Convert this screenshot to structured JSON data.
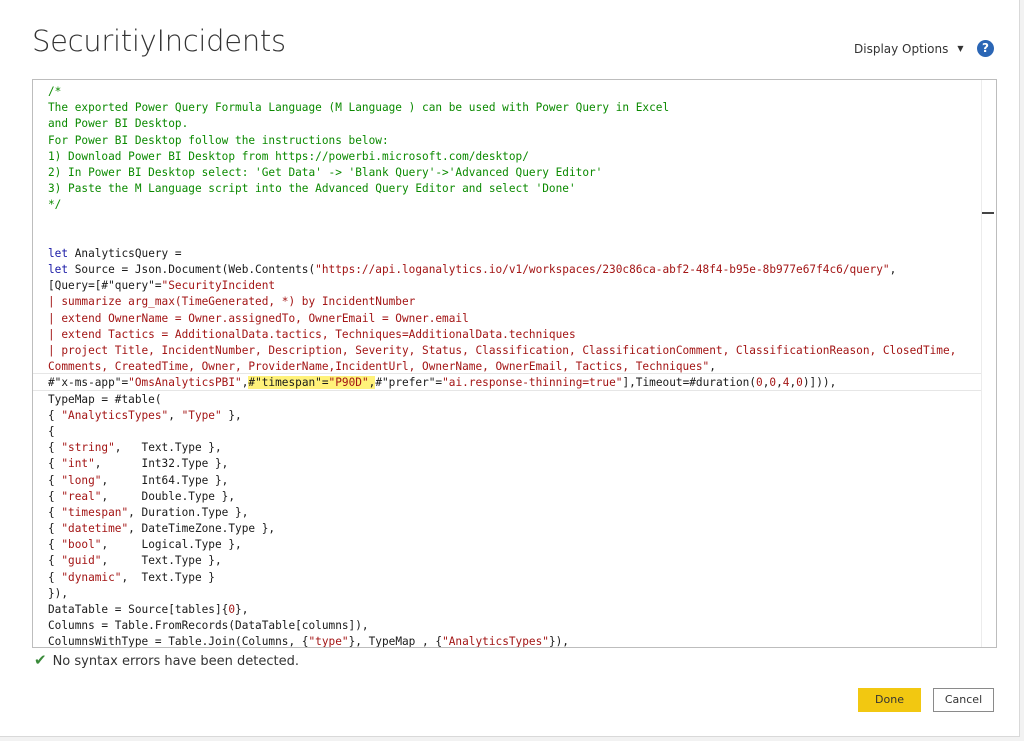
{
  "window": {
    "title": "SecuritiyIncidents"
  },
  "header": {
    "display_options_label": "Display Options",
    "help_label": "?"
  },
  "editor": {
    "lines": [
      [
        {
          "t": "/*",
          "c": "cm"
        }
      ],
      [
        {
          "t": "The exported Power Query Formula Language (M Language ) can be used with Power Query in Excel",
          "c": "cm"
        }
      ],
      [
        {
          "t": "and Power BI Desktop.",
          "c": "cm"
        }
      ],
      [
        {
          "t": "For Power BI Desktop follow the instructions below:",
          "c": "cm"
        }
      ],
      [
        {
          "t": "1) Download Power BI Desktop from https://powerbi.microsoft.com/desktop/",
          "c": "cm"
        }
      ],
      [
        {
          "t": "2) In Power BI Desktop select: 'Get Data' -> 'Blank Query'->'Advanced Query Editor'",
          "c": "cm"
        }
      ],
      [
        {
          "t": "3) Paste the M Language script into the Advanced Query Editor and select 'Done'",
          "c": "cm"
        }
      ],
      [
        {
          "t": "*/",
          "c": "cm"
        }
      ],
      [],
      [],
      [
        {
          "t": "let",
          "c": "kw"
        },
        {
          "t": " AnalyticsQuery =",
          "c": ""
        }
      ],
      [
        {
          "t": "let",
          "c": "kw"
        },
        {
          "t": " Source = Json.Document(Web.Contents(",
          "c": ""
        },
        {
          "t": "\"https://api.loganalytics.io/v1/workspaces/230c86ca-abf2-48f4-b95e-8b977e67f4c6/query\"",
          "c": "st"
        },
        {
          "t": ",",
          "c": ""
        }
      ],
      [
        {
          "t": "[Query=[#\"query\"=",
          "c": ""
        },
        {
          "t": "\"SecurityIncident",
          "c": "st"
        }
      ],
      [
        {
          "t": "| summarize arg_max(TimeGenerated, *) by IncidentNumber",
          "c": "st"
        }
      ],
      [
        {
          "t": "| extend OwnerName = Owner.assignedTo, OwnerEmail = Owner.email",
          "c": "st"
        }
      ],
      [
        {
          "t": "| extend Tactics = AdditionalData.tactics, Techniques=AdditionalData.techniques",
          "c": "st"
        }
      ],
      [
        {
          "t": "| project Title, IncidentNumber, Description, Severity, Status, Classification, ClassificationComment, ClassificationReason, ClosedTime,",
          "c": "st"
        }
      ],
      [
        {
          "t": "Comments, CreatedTime, Owner, ProviderName,IncidentUrl, OwnerName, OwnerEmail, Tactics, Techniques\"",
          "c": "st"
        },
        {
          "t": ",",
          "c": ""
        }
      ],
      [
        {
          "t": "#\"x-ms-app\"=",
          "c": ""
        },
        {
          "t": "\"OmsAnalyticsPBI\"",
          "c": "st"
        },
        {
          "t": ",",
          "c": ""
        },
        {
          "t": "#\"timespan\"=",
          "c": "hl"
        },
        {
          "t": "\"P90D\"",
          "c": "st hl"
        },
        {
          "t": ",",
          "c": "hl"
        },
        {
          "t": "#\"prefer\"=",
          "c": ""
        },
        {
          "t": "\"ai.response-thinning=true\"",
          "c": "st"
        },
        {
          "t": "],Timeout=#duration(",
          "c": ""
        },
        {
          "t": "0",
          "c": "st"
        },
        {
          "t": ",",
          "c": ""
        },
        {
          "t": "0",
          "c": "st"
        },
        {
          "t": ",",
          "c": ""
        },
        {
          "t": "4",
          "c": "st"
        },
        {
          "t": ",",
          "c": ""
        },
        {
          "t": "0",
          "c": "st"
        },
        {
          "t": ")])),",
          "c": ""
        }
      ],
      [
        {
          "t": "TypeMap = #table(",
          "c": ""
        }
      ],
      [
        {
          "t": "{ ",
          "c": ""
        },
        {
          "t": "\"AnalyticsTypes\"",
          "c": "st"
        },
        {
          "t": ", ",
          "c": ""
        },
        {
          "t": "\"Type\"",
          "c": "st"
        },
        {
          "t": " },",
          "c": ""
        }
      ],
      [
        {
          "t": "{",
          "c": ""
        }
      ],
      [
        {
          "t": "{ ",
          "c": ""
        },
        {
          "t": "\"string\"",
          "c": "st"
        },
        {
          "t": ",   Text.Type },",
          "c": ""
        }
      ],
      [
        {
          "t": "{ ",
          "c": ""
        },
        {
          "t": "\"int\"",
          "c": "st"
        },
        {
          "t": ",      Int32.Type },",
          "c": ""
        }
      ],
      [
        {
          "t": "{ ",
          "c": ""
        },
        {
          "t": "\"long\"",
          "c": "st"
        },
        {
          "t": ",     Int64.Type },",
          "c": ""
        }
      ],
      [
        {
          "t": "{ ",
          "c": ""
        },
        {
          "t": "\"real\"",
          "c": "st"
        },
        {
          "t": ",     Double.Type },",
          "c": ""
        }
      ],
      [
        {
          "t": "{ ",
          "c": ""
        },
        {
          "t": "\"timespan\"",
          "c": "st"
        },
        {
          "t": ", Duration.Type },",
          "c": ""
        }
      ],
      [
        {
          "t": "{ ",
          "c": ""
        },
        {
          "t": "\"datetime\"",
          "c": "st"
        },
        {
          "t": ", DateTimeZone.Type },",
          "c": ""
        }
      ],
      [
        {
          "t": "{ ",
          "c": ""
        },
        {
          "t": "\"bool\"",
          "c": "st"
        },
        {
          "t": ",     Logical.Type },",
          "c": ""
        }
      ],
      [
        {
          "t": "{ ",
          "c": ""
        },
        {
          "t": "\"guid\"",
          "c": "st"
        },
        {
          "t": ",     Text.Type },",
          "c": ""
        }
      ],
      [
        {
          "t": "{ ",
          "c": ""
        },
        {
          "t": "\"dynamic\"",
          "c": "st"
        },
        {
          "t": ",  Text.Type }",
          "c": ""
        }
      ],
      [
        {
          "t": "}),",
          "c": ""
        }
      ],
      [
        {
          "t": "DataTable = Source[tables]{",
          "c": ""
        },
        {
          "t": "0",
          "c": "st"
        },
        {
          "t": "},",
          "c": ""
        }
      ],
      [
        {
          "t": "Columns = Table.FromRecords(DataTable[columns]),",
          "c": ""
        }
      ],
      [
        {
          "t": "ColumnsWithType = Table.Join(Columns, {",
          "c": ""
        },
        {
          "t": "\"type\"",
          "c": "st"
        },
        {
          "t": "}, TypeMap , {",
          "c": ""
        },
        {
          "t": "\"AnalyticsTypes\"",
          "c": "st"
        },
        {
          "t": "}),",
          "c": ""
        }
      ]
    ]
  },
  "status": {
    "message": "No syntax errors have been detected."
  },
  "footer": {
    "done_label": "Done",
    "cancel_label": "Cancel"
  },
  "colors": {
    "accent": "#f2c811",
    "comment": "#0b8a00",
    "string": "#a31515",
    "keyword": "#1a1aa6",
    "highlight": "#fff27a",
    "help": "#2b66b5"
  }
}
